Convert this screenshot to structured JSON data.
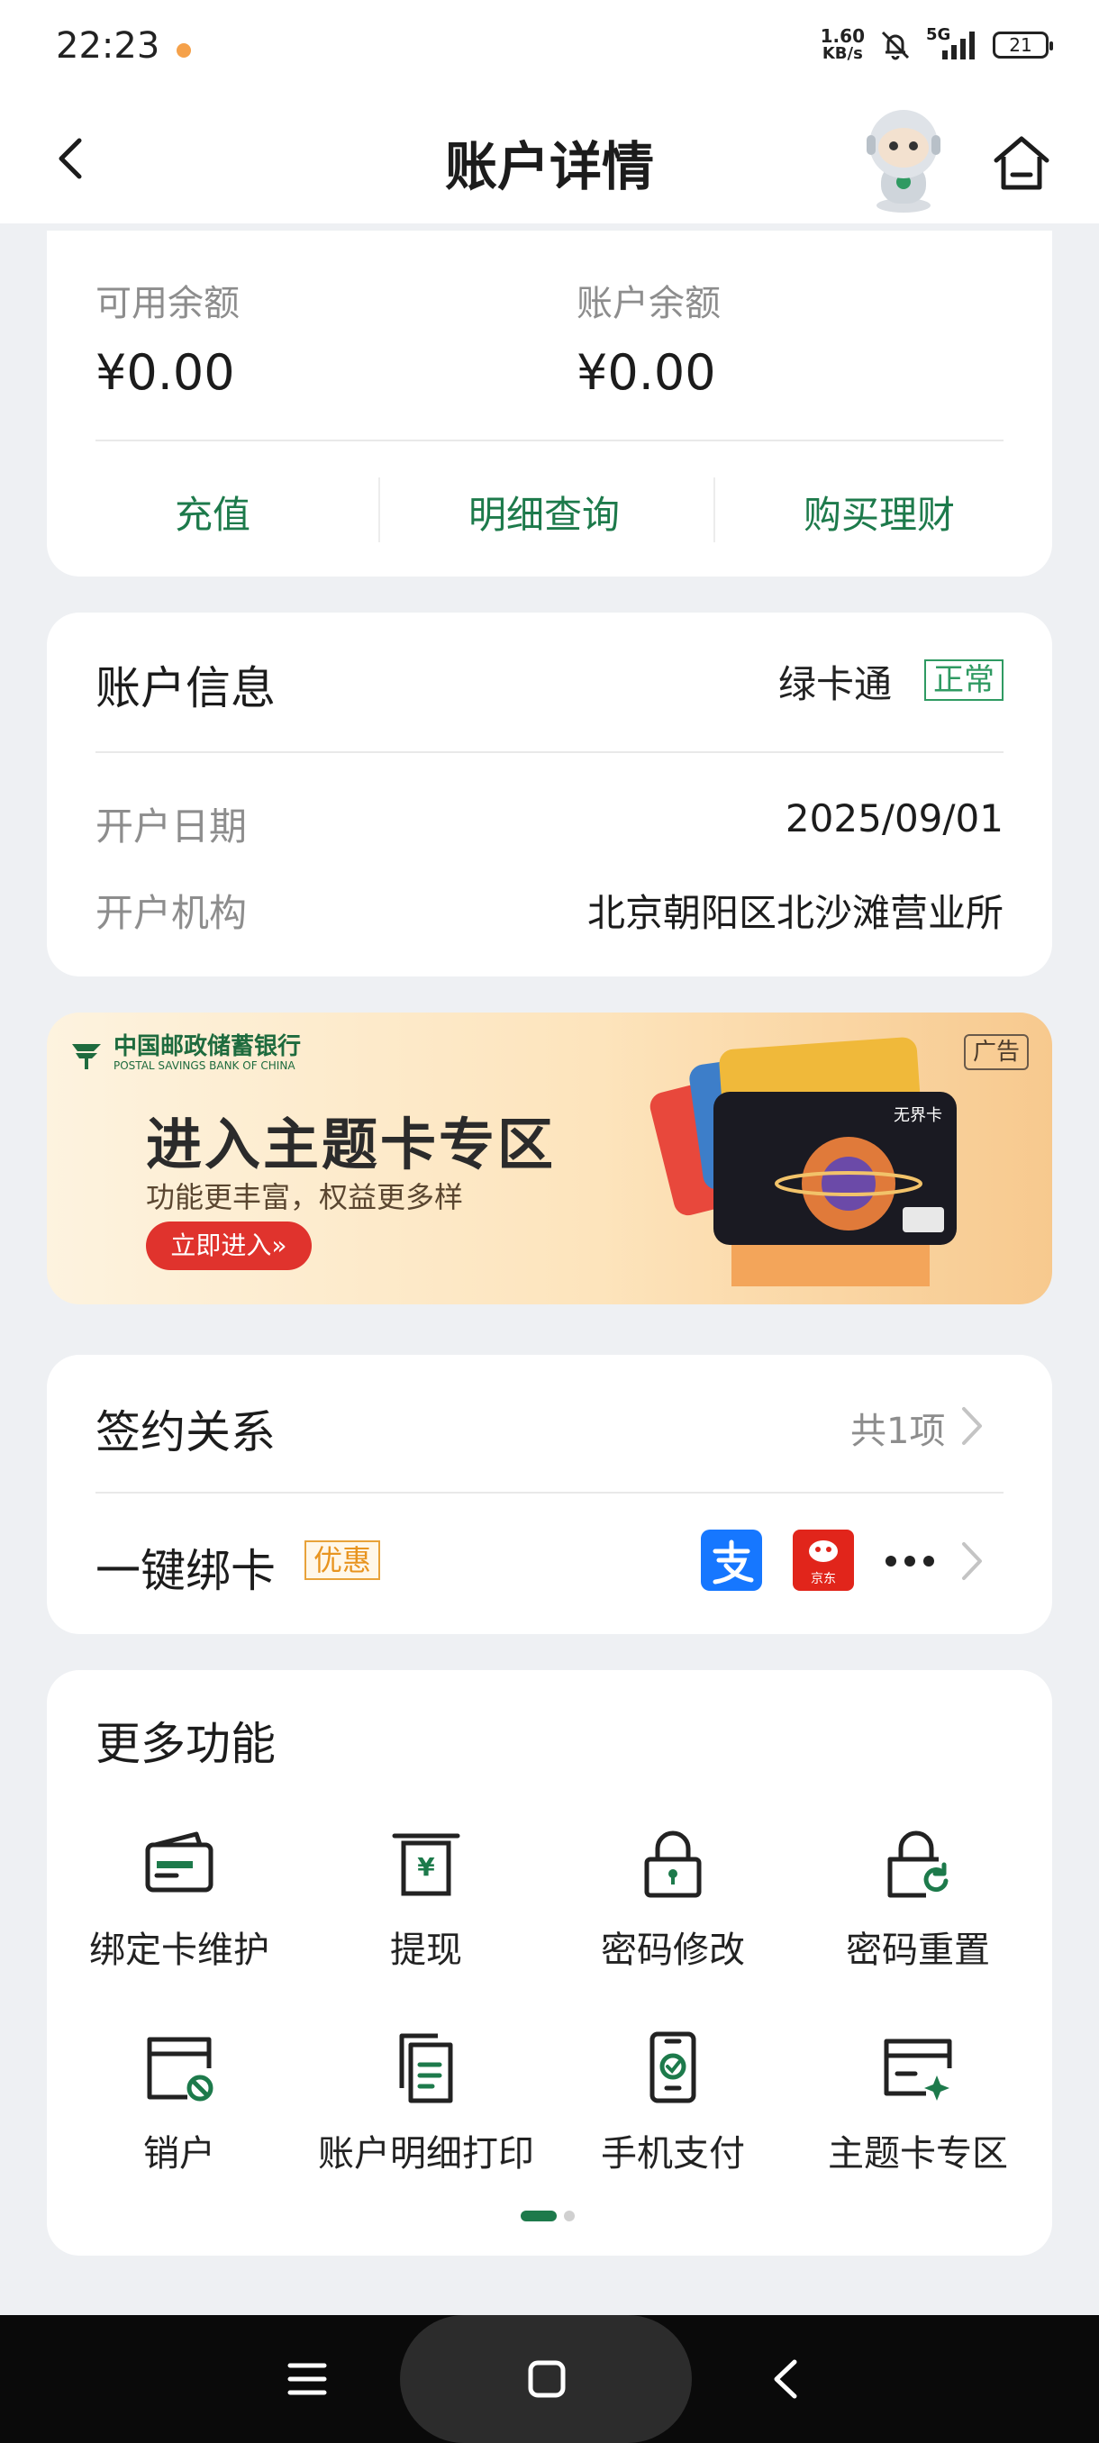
{
  "status_bar": {
    "time": "22:23",
    "speed_value": "1.60",
    "speed_unit": "KB/s",
    "network": "5G",
    "battery": "21",
    "icons": [
      "notification-dot",
      "mute-bell-icon",
      "signal-icon",
      "battery-icon"
    ]
  },
  "nav": {
    "title": "账户详情",
    "icons": [
      "back-icon",
      "assistant-robot-icon",
      "home-icon"
    ]
  },
  "balance": {
    "available_label": "可用余额",
    "available_value": "¥0.00",
    "account_label": "账户余额",
    "account_value": "¥0.00",
    "actions": [
      "充值",
      "明细查询",
      "购买理财"
    ]
  },
  "account_info": {
    "heading": "账户信息",
    "card_type": "绿卡通",
    "status": "正常",
    "open_date_label": "开户日期",
    "open_date": "2025/09/01",
    "branch_label": "开户机构",
    "branch": "北京朝阳区北沙滩营业所"
  },
  "banner": {
    "bank_name": "中国邮政储蓄银行",
    "bank_name_en": "POSTAL SAVINGS BANK OF CHINA",
    "title": "进入主题卡专区",
    "subtitle": "功能更丰富，权益更多样",
    "button": "立即进入»",
    "ad_tag": "广告",
    "card_text": "无界卡"
  },
  "signing": {
    "label": "签约关系",
    "count": "共1项",
    "bind_label": "一键绑卡",
    "bind_badge": "优惠",
    "bind_icons": [
      "alipay-icon",
      "jd-icon",
      "more-icon"
    ],
    "jd_text": "京东"
  },
  "more_features": {
    "heading": "更多功能",
    "items": [
      {
        "label": "绑定卡维护",
        "icon": "bound-card-icon"
      },
      {
        "label": "提现",
        "icon": "withdraw-icon"
      },
      {
        "label": "密码修改",
        "icon": "password-change-icon"
      },
      {
        "label": "密码重置",
        "icon": "password-reset-icon"
      },
      {
        "label": "销户",
        "icon": "close-account-icon"
      },
      {
        "label": "账户明细打印",
        "icon": "statement-print-icon"
      },
      {
        "label": "手机支付",
        "icon": "mobile-pay-icon"
      },
      {
        "label": "主题卡专区",
        "icon": "theme-card-icon"
      }
    ],
    "page": "1",
    "page_count": "2"
  },
  "colors": {
    "accent_green": "#1d7a4b",
    "badge_orange": "#e8941f",
    "banner_button": "#e0332d"
  }
}
